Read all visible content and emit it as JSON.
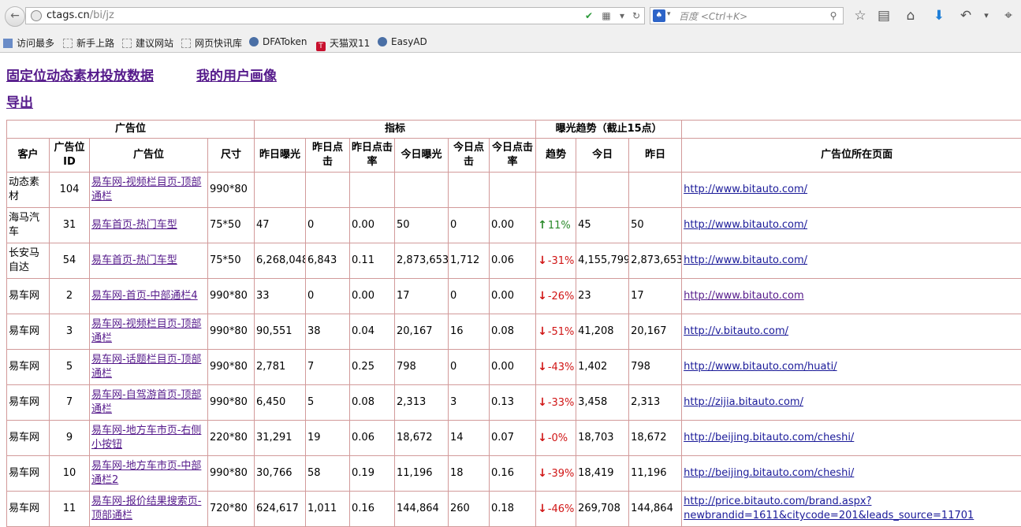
{
  "browser": {
    "url_host": "ctags.cn",
    "url_path": "/bi/jz",
    "search_placeholder": "百度 <Ctrl+K>",
    "bookmarks": [
      "访问最多",
      "新手上路",
      "建议网站",
      "网页快讯库",
      "DFAToken",
      "天猫双11",
      "EasyAD"
    ]
  },
  "page": {
    "link_fixed": "固定位动态素材投放数据",
    "link_profile": "我的用户画像",
    "link_export": "导出"
  },
  "table": {
    "group_headers": [
      "广告位",
      "指标",
      "曝光趋势（截止15点）"
    ],
    "columns": [
      "客户",
      "广告位ID",
      "广告位",
      "尺寸",
      "昨日曝光",
      "昨日点击",
      "昨日点击率",
      "今日曝光",
      "今日点击",
      "今日点击率",
      "趋势",
      "今日",
      "昨日",
      "广告位所在页面"
    ],
    "rows": [
      {
        "client": "动态素材",
        "id": "104",
        "position": "易车网-视频栏目页-顶部通栏",
        "size": "990*80",
        "y_imp": "",
        "y_clk": "",
        "y_ctr": "",
        "t_imp": "",
        "t_clk": "",
        "t_ctr": "",
        "trend_dir": "",
        "trend": "",
        "today": "",
        "yesterday": "",
        "page_url": "http://www.bitauto.com/"
      },
      {
        "client": "海马汽车",
        "id": "31",
        "position": "易车首页-热门车型",
        "size": "75*50",
        "y_imp": "47",
        "y_clk": "0",
        "y_ctr": "0.00",
        "t_imp": "50",
        "t_clk": "0",
        "t_ctr": "0.00",
        "trend_dir": "up",
        "trend": "11%",
        "today": "45",
        "yesterday": "50",
        "page_url": "http://www.bitauto.com/"
      },
      {
        "client": "长安马自达",
        "id": "54",
        "position": "易车首页-热门车型",
        "size": "75*50",
        "y_imp": "6,268,048",
        "y_clk": "6,843",
        "y_ctr": "0.11",
        "t_imp": "2,873,653",
        "t_clk": "1,712",
        "t_ctr": "0.06",
        "trend_dir": "down",
        "trend": "-31%",
        "today": "4,155,799",
        "yesterday": "2,873,653",
        "page_url": "http://www.bitauto.com/"
      },
      {
        "client": "易车网",
        "id": "2",
        "position": "易车网-首页-中部通栏4",
        "size": "990*80",
        "y_imp": "33",
        "y_clk": "0",
        "y_ctr": "0.00",
        "t_imp": "17",
        "t_clk": "0",
        "t_ctr": "0.00",
        "trend_dir": "down",
        "trend": "-26%",
        "today": "23",
        "yesterday": "17",
        "page_url": "http://www.bitauto.com"
      },
      {
        "client": "易车网",
        "id": "3",
        "position": "易车网-视频栏目页-顶部通栏",
        "size": "990*80",
        "y_imp": "90,551",
        "y_clk": "38",
        "y_ctr": "0.04",
        "t_imp": "20,167",
        "t_clk": "16",
        "t_ctr": "0.08",
        "trend_dir": "down",
        "trend": "-51%",
        "today": "41,208",
        "yesterday": "20,167",
        "page_url": "http://v.bitauto.com/"
      },
      {
        "client": "易车网",
        "id": "5",
        "position": "易车网-话题栏目页-顶部通栏",
        "size": "990*80",
        "y_imp": "2,781",
        "y_clk": "7",
        "y_ctr": "0.25",
        "t_imp": "798",
        "t_clk": "0",
        "t_ctr": "0.00",
        "trend_dir": "down",
        "trend": "-43%",
        "today": "1,402",
        "yesterday": "798",
        "page_url": "http://www.bitauto.com/huati/"
      },
      {
        "client": "易车网",
        "id": "7",
        "position": "易车网-自驾游首页-顶部通栏",
        "size": "990*80",
        "y_imp": "6,450",
        "y_clk": "5",
        "y_ctr": "0.08",
        "t_imp": "2,313",
        "t_clk": "3",
        "t_ctr": "0.13",
        "trend_dir": "down",
        "trend": "-33%",
        "today": "3,458",
        "yesterday": "2,313",
        "page_url": "http://zijia.bitauto.com/"
      },
      {
        "client": "易车网",
        "id": "9",
        "position": "易车网-地方车市页-右侧小按钮",
        "size": "220*80",
        "y_imp": "31,291",
        "y_clk": "19",
        "y_ctr": "0.06",
        "t_imp": "18,672",
        "t_clk": "14",
        "t_ctr": "0.07",
        "trend_dir": "down",
        "trend": "-0%",
        "today": "18,703",
        "yesterday": "18,672",
        "page_url": "http://beijing.bitauto.com/cheshi/"
      },
      {
        "client": "易车网",
        "id": "10",
        "position": "易车网-地方车市页-中部通栏2",
        "size": "990*80",
        "y_imp": "30,766",
        "y_clk": "58",
        "y_ctr": "0.19",
        "t_imp": "11,196",
        "t_clk": "18",
        "t_ctr": "0.16",
        "trend_dir": "down",
        "trend": "-39%",
        "today": "18,419",
        "yesterday": "11,196",
        "page_url": "http://beijing.bitauto.com/cheshi/"
      },
      {
        "client": "易车网",
        "id": "11",
        "position": "易车网-报价结果搜索页-顶部通栏",
        "size": "720*80",
        "y_imp": "624,617",
        "y_clk": "1,011",
        "y_ctr": "0.16",
        "t_imp": "144,864",
        "t_clk": "260",
        "t_ctr": "0.18",
        "trend_dir": "down",
        "trend": "-46%",
        "today": "269,708",
        "yesterday": "144,864",
        "page_url": "http://price.bitauto.com/brand.aspx?newbrandid=1611&citycode=201&leads_source=11701"
      }
    ]
  },
  "colors": {
    "up": "#2a8a2a",
    "down": "#d01515",
    "link": "#551a8b",
    "border": "#d29a9a"
  }
}
